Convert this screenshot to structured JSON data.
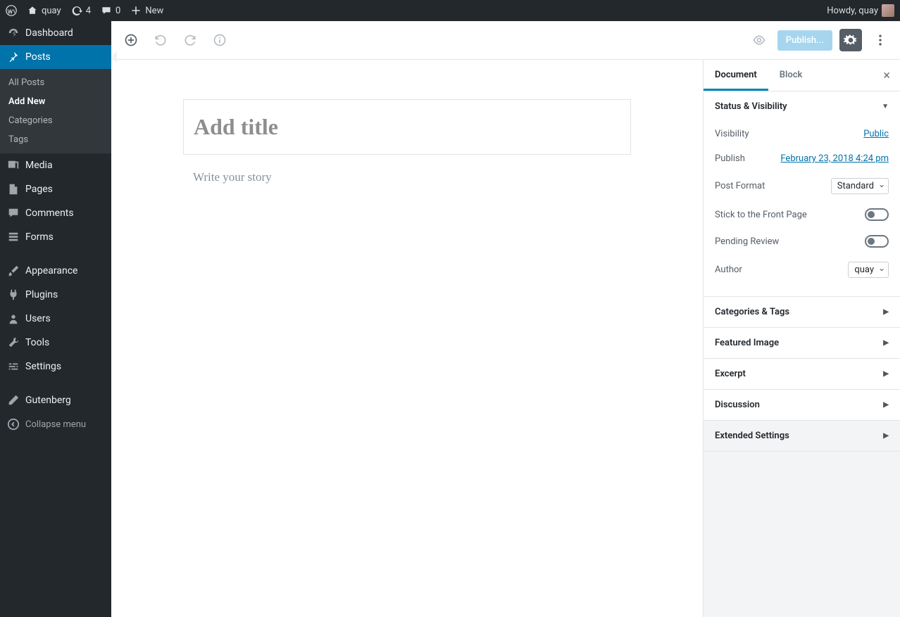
{
  "adminBar": {
    "siteName": "quay",
    "updates": "4",
    "comments": "0",
    "new": "New",
    "howdy": "Howdy, quay"
  },
  "sidebar": {
    "items": [
      {
        "label": "Dashboard",
        "icon": "dashboard"
      },
      {
        "label": "Posts",
        "icon": "pin",
        "active": true,
        "subs": [
          {
            "label": "All Posts"
          },
          {
            "label": "Add New",
            "current": true
          },
          {
            "label": "Categories"
          },
          {
            "label": "Tags"
          }
        ]
      },
      {
        "label": "Media",
        "icon": "media"
      },
      {
        "label": "Pages",
        "icon": "page"
      },
      {
        "label": "Comments",
        "icon": "comment"
      },
      {
        "label": "Forms",
        "icon": "forms"
      },
      {
        "label": "__spacer"
      },
      {
        "label": "Appearance",
        "icon": "brush"
      },
      {
        "label": "Plugins",
        "icon": "plug"
      },
      {
        "label": "Users",
        "icon": "user"
      },
      {
        "label": "Tools",
        "icon": "wrench"
      },
      {
        "label": "Settings",
        "icon": "sliders"
      },
      {
        "label": "__spacer"
      },
      {
        "label": "Gutenberg",
        "icon": "edit"
      }
    ],
    "collapse": "Collapse menu"
  },
  "toolbar": {
    "publish": "Publish..."
  },
  "editor": {
    "titlePlaceholder": "Add title",
    "bodyPlaceholder": "Write your story"
  },
  "rpanel": {
    "tabs": {
      "document": "Document",
      "block": "Block"
    },
    "status": {
      "heading": "Status & Visibility",
      "visibilityLabel": "Visibility",
      "visibilityValue": "Public",
      "publishLabel": "Publish",
      "publishValue": "February 23, 2018 4:24 pm",
      "postFormatLabel": "Post Format",
      "postFormatValue": "Standard",
      "stickLabel": "Stick to the Front Page",
      "pendingLabel": "Pending Review",
      "authorLabel": "Author",
      "authorValue": "quay"
    },
    "sections": {
      "catsTags": "Categories & Tags",
      "featured": "Featured Image",
      "excerpt": "Excerpt",
      "discussion": "Discussion",
      "extended": "Extended Settings"
    }
  }
}
